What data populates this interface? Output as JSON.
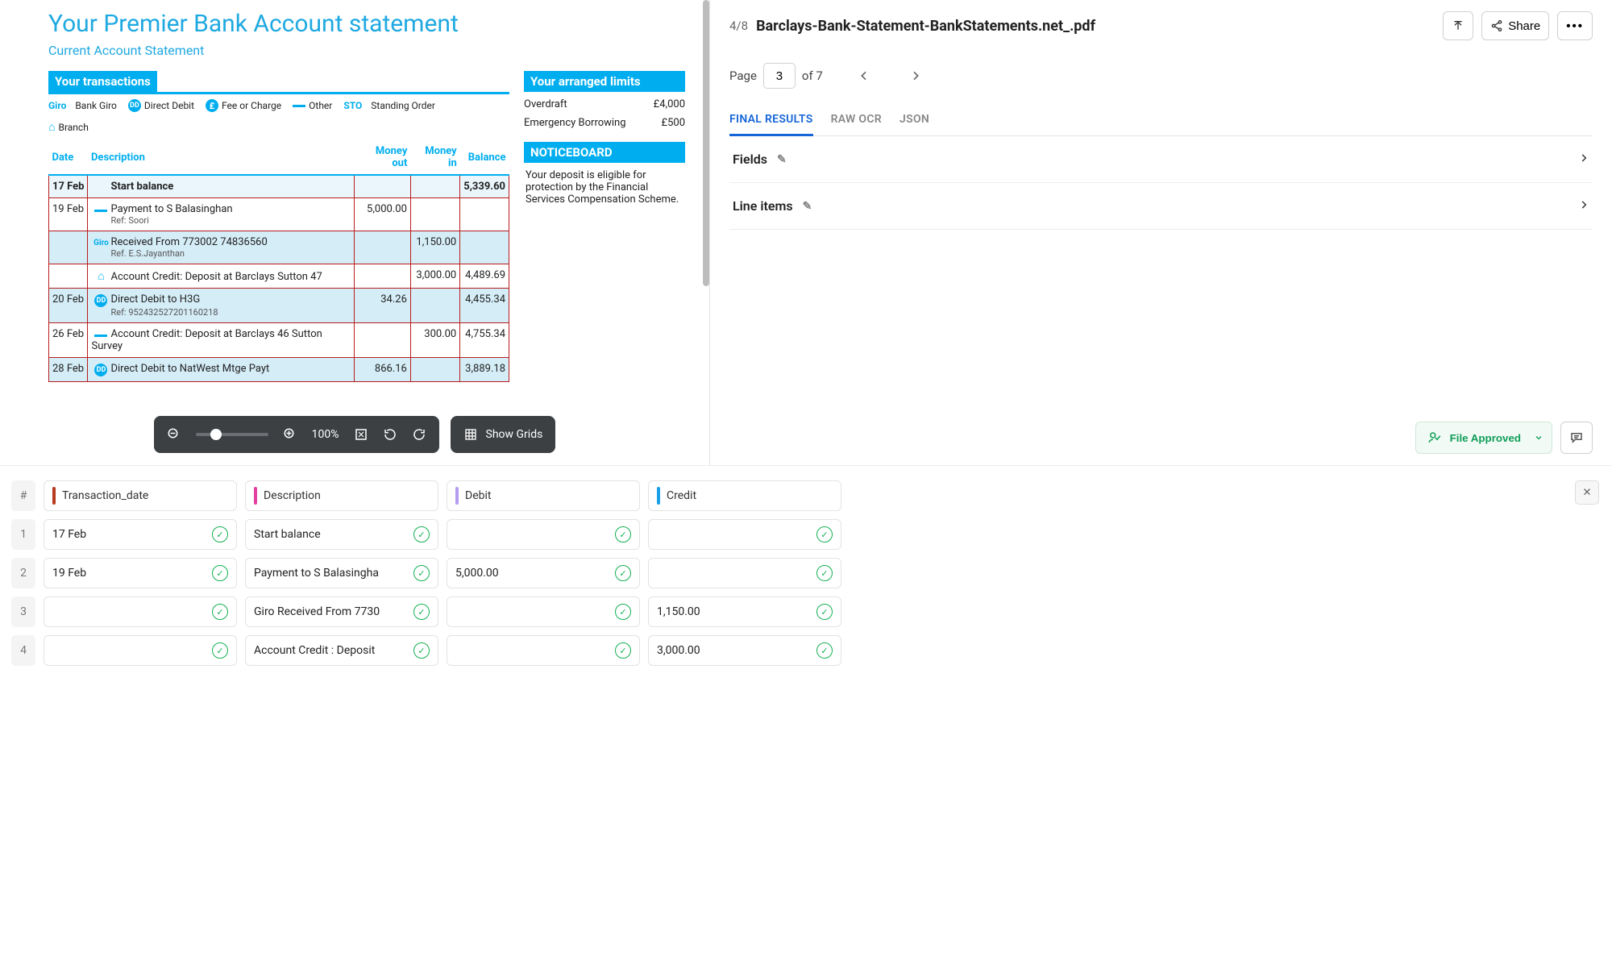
{
  "document": {
    "title": "Your Premier Bank Account statement",
    "subtitle": "Current Account Statement",
    "transactions_header": "Your transactions",
    "legend": {
      "giro": "Bank Giro",
      "giro_tag": "Giro",
      "dd": "Direct Debit",
      "fee": "Fee or Charge",
      "other": "Other",
      "sto": "Standing Order",
      "sto_tag": "STO",
      "branch": "Branch"
    },
    "columns": {
      "date": "Date",
      "desc": "Description",
      "out": "Money out",
      "in": "Money in",
      "bal": "Balance"
    },
    "rows": [
      {
        "date": "17 Feb",
        "desc": "Start balance",
        "out": "",
        "in": "",
        "bal": "5,339.60",
        "start": true
      },
      {
        "date": "19 Feb",
        "icon": "other",
        "desc": "Payment to S Balasinghan",
        "sub": "Ref: Soori",
        "out": "5,000.00",
        "in": "",
        "bal": ""
      },
      {
        "date": "",
        "icon": "giro",
        "desc": "Received From 773002 74836560",
        "sub": "Ref. E.S.Jayanthan",
        "out": "",
        "in": "1,150.00",
        "bal": "",
        "shade": true
      },
      {
        "date": "",
        "icon": "branch",
        "desc": "Account Credit: Deposit at Barclays Sutton 47",
        "out": "",
        "in": "3,000.00",
        "bal": "4,489.69"
      },
      {
        "date": "20 Feb",
        "icon": "dd",
        "desc": "Direct Debit to H3G",
        "sub": "Ref: 952432527201160218",
        "out": "34.26",
        "in": "",
        "bal": "4,455.34",
        "shade": true
      },
      {
        "date": "26 Feb",
        "icon": "other",
        "desc": "Account Credit: Deposit at Barclays 46 Sutton Survey",
        "out": "",
        "in": "300.00",
        "bal": "4,755.34"
      },
      {
        "date": "28 Feb",
        "icon": "dd",
        "desc": "Direct Debit to NatWest Mtge Payt",
        "out": "866.16",
        "in": "",
        "bal": "3,889.18",
        "shade": true
      }
    ],
    "limits": {
      "header": "Your arranged limits",
      "rows": [
        {
          "label": "Overdraft",
          "value": "£4,000"
        },
        {
          "label": "Emergency Borrowing",
          "value": "£500"
        }
      ]
    },
    "notice": {
      "header": "NOTICEBOARD",
      "text": "Your deposit is eligible for protection by the Financial Services Compensation Scheme."
    }
  },
  "toolbar": {
    "zoom": "100%",
    "show_grids": "Show Grids"
  },
  "right": {
    "counter": "4/8",
    "filename": "Barclays-Bank-Statement-BankStatements.net_.pdf",
    "share": "Share",
    "page_label": "Page",
    "page_value": "3",
    "page_total": "of 7",
    "tabs": {
      "final": "FINAL RESULTS",
      "raw": "RAW OCR",
      "json": "JSON"
    },
    "sections": {
      "fields": "Fields",
      "line_items": "Line items"
    },
    "approved": "File Approved"
  },
  "bottom": {
    "columns": [
      {
        "label": "Transaction_date",
        "color": "#b73a1e"
      },
      {
        "label": "Description",
        "color": "#e23fa0"
      },
      {
        "label": "Debit",
        "color": "#b49df0"
      },
      {
        "label": "Credit",
        "color": "#1aa0e8"
      }
    ],
    "rows": [
      {
        "n": "1",
        "cells": [
          "17 Feb",
          "Start balance",
          "",
          ""
        ]
      },
      {
        "n": "2",
        "cells": [
          "19 Feb",
          "Payment to S Balasingha",
          "5,000.00",
          ""
        ]
      },
      {
        "n": "3",
        "cells": [
          "",
          "Giro Received From 7730",
          "",
          "1,150.00"
        ]
      },
      {
        "n": "4",
        "cells": [
          "",
          "Account Credit : Deposit",
          "",
          "3,000.00"
        ]
      }
    ],
    "hash": "#"
  }
}
